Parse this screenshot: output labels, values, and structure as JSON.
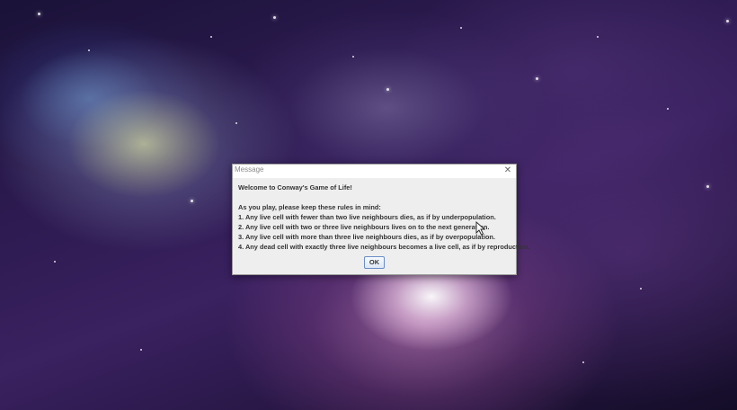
{
  "dialog": {
    "title": "Message",
    "welcome": "Welcome to Conway's Game of Life!",
    "intro": "As you play, please keep these rules in mind:",
    "rules": [
      "1. Any live cell with fewer than two live neighbours dies, as if by underpopulation.",
      "2. Any live cell with two or three live neighbours lives on to the next generation.",
      "3. Any live cell with more than three live neighbours dies, as if by overpopulation.",
      "4. Any dead cell with exactly three live neighbours becomes a live cell, as if by reproduction."
    ],
    "ok_label": "OK"
  },
  "icons": {
    "close": "close-icon",
    "cursor": "mouse-pointer-icon"
  },
  "colors": {
    "dialog_bg": "#eeeeee",
    "titlebar_bg": "#ffffff",
    "button_border": "#6a8cc7"
  }
}
